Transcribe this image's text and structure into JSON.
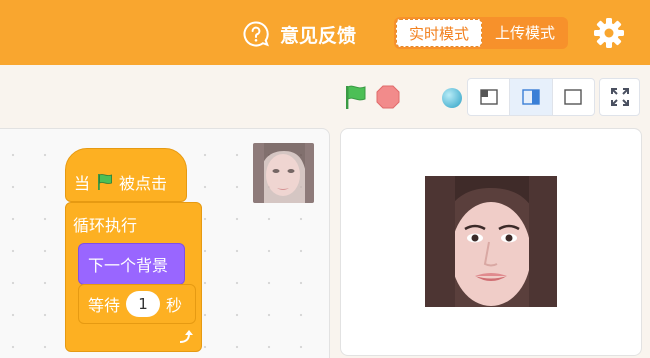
{
  "header": {
    "feedback_label": "意见反馈",
    "modes": {
      "active": "实时模式",
      "inactive": "上传模式"
    }
  },
  "blocks": {
    "hat_prefix": "当",
    "hat_suffix": "被点击",
    "forever": "循环执行",
    "next_backdrop": "下一个背景",
    "wait_prefix": "等待",
    "wait_value": "1",
    "wait_suffix": "秒"
  },
  "icons": {
    "feedback": "question-circle-icon",
    "settings": "gear-icon",
    "green_flag": "green-flag-icon",
    "stop": "stop-icon",
    "small_stage": "small-stage-layout-icon",
    "normal_stage": "normal-stage-layout-icon",
    "large_stage": "large-stage-layout-icon",
    "fullscreen": "fullscreen-icon",
    "loop_arrow": "loop-arrow-icon"
  },
  "colors": {
    "header": "#f9a62f",
    "events_block": "#fdb022",
    "looks_block": "#9966ff",
    "green_flag": "#4cbf56",
    "stop": "#f07a7a",
    "active_mode_text": "#f2811f"
  }
}
